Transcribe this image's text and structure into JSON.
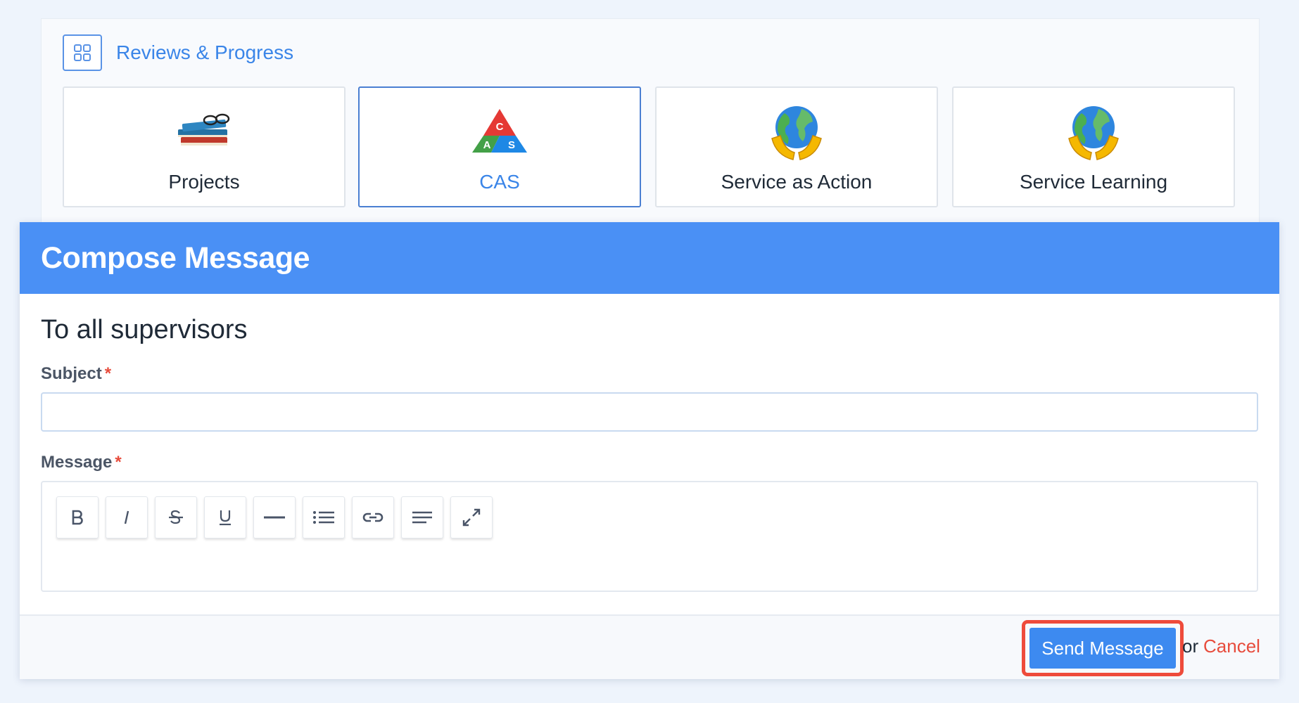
{
  "section": {
    "title": "Reviews & Progress",
    "icon": "grid-icon"
  },
  "cards": [
    {
      "label": "Projects",
      "icon": "books-icon",
      "selected": false
    },
    {
      "label": "CAS",
      "icon": "cas-triangle-icon",
      "selected": true,
      "letters": [
        "C",
        "A",
        "S"
      ]
    },
    {
      "label": "Service as Action",
      "icon": "globe-hands-icon",
      "selected": false
    },
    {
      "label": "Service Learning",
      "icon": "globe-hands-icon",
      "selected": false
    }
  ],
  "modal": {
    "title": "Compose Message",
    "recipients": "To all supervisors",
    "subject_label": "Subject",
    "subject_value": "",
    "message_label": "Message",
    "required_marker": "*",
    "toolbar": [
      {
        "name": "bold",
        "icon": "bold-icon"
      },
      {
        "name": "italic",
        "icon": "italic-icon"
      },
      {
        "name": "strikethrough",
        "icon": "strikethrough-icon"
      },
      {
        "name": "underline",
        "icon": "underline-icon"
      },
      {
        "name": "horizontal-rule",
        "icon": "horizontal-rule-icon"
      },
      {
        "name": "bullet-list",
        "icon": "bullet-list-icon"
      },
      {
        "name": "link",
        "icon": "link-icon"
      },
      {
        "name": "align",
        "icon": "align-left-icon"
      },
      {
        "name": "fullscreen",
        "icon": "expand-icon"
      }
    ],
    "send_label": "Send Message",
    "or_text": "or",
    "cancel_label": "Cancel"
  },
  "colors": {
    "accent": "#3a85e8",
    "header": "#4a90f5",
    "required": "#e74c3c",
    "highlight": "#ee4b3b",
    "page_bg": "#eef4fc"
  }
}
